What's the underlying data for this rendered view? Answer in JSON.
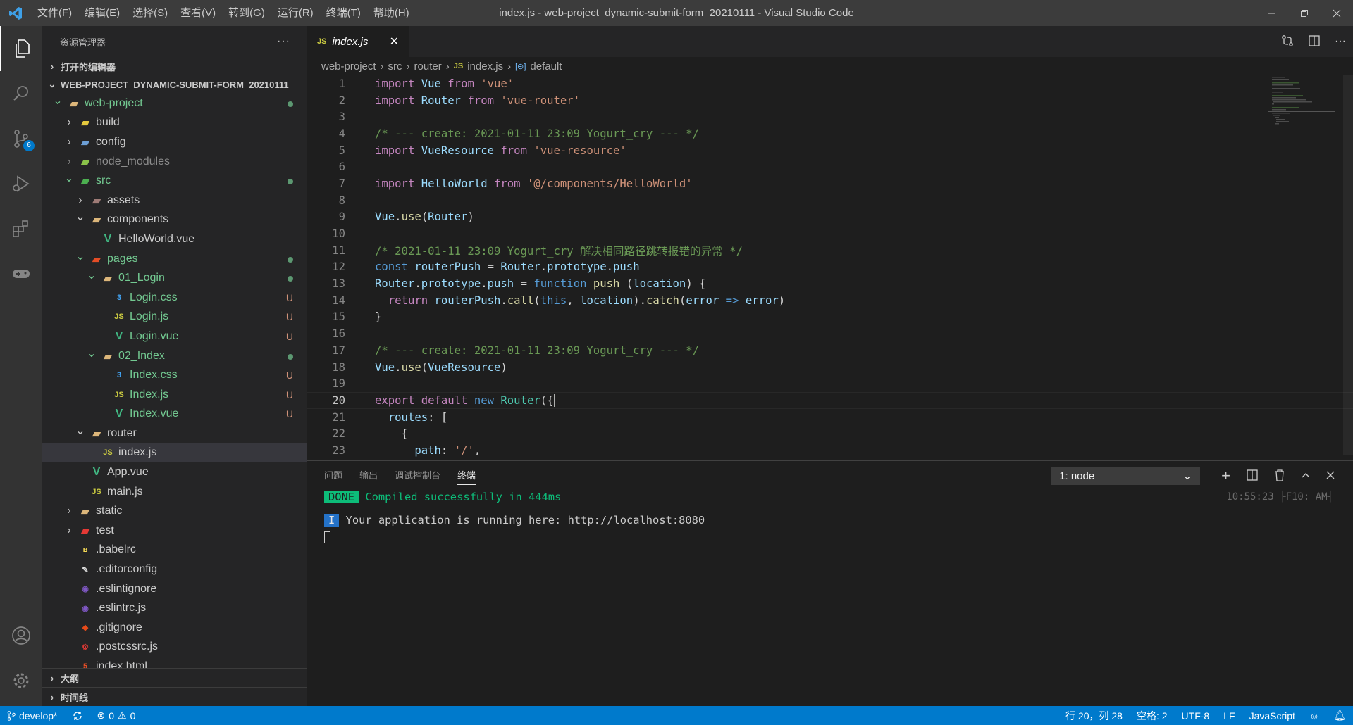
{
  "window": {
    "title": "index.js - web-project_dynamic-submit-form_20210111 - Visual Studio Code"
  },
  "menu": [
    "文件(F)",
    "编辑(E)",
    "选择(S)",
    "查看(V)",
    "转到(G)",
    "运行(R)",
    "终端(T)",
    "帮助(H)"
  ],
  "activity": {
    "scm_badge": "6"
  },
  "explorer": {
    "title": "资源管理器",
    "open_editors": "打开的编辑器",
    "root": "WEB-PROJECT_DYNAMIC-SUBMIT-FORM_20210111",
    "outline": "大纲",
    "timeline": "时间线"
  },
  "tree": [
    {
      "label": "web-project",
      "depth": 0,
      "twistie": "v",
      "icon": "folder",
      "status": "dot",
      "git": true
    },
    {
      "label": "build",
      "depth": 1,
      "twistie": ">",
      "icon": "folder-build",
      "status": ""
    },
    {
      "label": "config",
      "depth": 1,
      "twistie": ">",
      "icon": "folder-config",
      "status": ""
    },
    {
      "label": "node_modules",
      "depth": 1,
      "twistie": ">",
      "icon": "folder-node",
      "status": "",
      "ignored": true
    },
    {
      "label": "src",
      "depth": 1,
      "twistie": "v",
      "icon": "folder-src",
      "status": "dot",
      "git": true
    },
    {
      "label": "assets",
      "depth": 2,
      "twistie": ">",
      "icon": "folder-assets",
      "status": ""
    },
    {
      "label": "components",
      "depth": 2,
      "twistie": "v",
      "icon": "folder",
      "status": ""
    },
    {
      "label": "HelloWorld.vue",
      "depth": 3,
      "twistie": "",
      "icon": "vue",
      "status": ""
    },
    {
      "label": "pages",
      "depth": 2,
      "twistie": "v",
      "icon": "folder-pages",
      "status": "dot",
      "git": true
    },
    {
      "label": "01_Login",
      "depth": 3,
      "twistie": "v",
      "icon": "folder",
      "status": "dot",
      "git": true
    },
    {
      "label": "Login.css",
      "depth": 4,
      "twistie": "",
      "icon": "css",
      "status": "U",
      "git": true
    },
    {
      "label": "Login.js",
      "depth": 4,
      "twistie": "",
      "icon": "js",
      "status": "U",
      "git": true
    },
    {
      "label": "Login.vue",
      "depth": 4,
      "twistie": "",
      "icon": "vue",
      "status": "U",
      "git": true
    },
    {
      "label": "02_Index",
      "depth": 3,
      "twistie": "v",
      "icon": "folder",
      "status": "dot",
      "git": true
    },
    {
      "label": "Index.css",
      "depth": 4,
      "twistie": "",
      "icon": "css",
      "status": "U",
      "git": true
    },
    {
      "label": "Index.js",
      "depth": 4,
      "twistie": "",
      "icon": "js",
      "status": "U",
      "git": true
    },
    {
      "label": "Index.vue",
      "depth": 4,
      "twistie": "",
      "icon": "vue",
      "status": "U",
      "git": true
    },
    {
      "label": "router",
      "depth": 2,
      "twistie": "v",
      "icon": "folder",
      "status": ""
    },
    {
      "label": "index.js",
      "depth": 3,
      "twistie": "",
      "icon": "js",
      "status": "",
      "selected": true
    },
    {
      "label": "App.vue",
      "depth": 2,
      "twistie": "",
      "icon": "vue",
      "status": ""
    },
    {
      "label": "main.js",
      "depth": 2,
      "twistie": "",
      "icon": "js",
      "status": ""
    },
    {
      "label": "static",
      "depth": 1,
      "twistie": ">",
      "icon": "folder",
      "status": ""
    },
    {
      "label": "test",
      "depth": 1,
      "twistie": ">",
      "icon": "folder-test",
      "status": ""
    },
    {
      "label": ".babelrc",
      "depth": 1,
      "twistie": "",
      "icon": "babel",
      "status": ""
    },
    {
      "label": ".editorconfig",
      "depth": 1,
      "twistie": "",
      "icon": "editorconfig",
      "status": ""
    },
    {
      "label": ".eslintignore",
      "depth": 1,
      "twistie": "",
      "icon": "eslint",
      "status": ""
    },
    {
      "label": ".eslintrc.js",
      "depth": 1,
      "twistie": "",
      "icon": "eslint",
      "status": ""
    },
    {
      "label": ".gitignore",
      "depth": 1,
      "twistie": "",
      "icon": "git",
      "status": ""
    },
    {
      "label": ".postcssrc.js",
      "depth": 1,
      "twistie": "",
      "icon": "postcss",
      "status": ""
    },
    {
      "label": "index.html",
      "depth": 1,
      "twistie": "",
      "icon": "html",
      "status": ""
    }
  ],
  "tab": {
    "label": "index.js",
    "icon": "JS"
  },
  "breadcrumb": [
    "web-project",
    "src",
    "router",
    "index.js",
    "default"
  ],
  "code": [
    [
      [
        "kw",
        "import"
      ],
      [
        "t",
        " "
      ],
      [
        "id",
        "Vue"
      ],
      [
        "t",
        " "
      ],
      [
        "kw",
        "from"
      ],
      [
        "t",
        " "
      ],
      [
        "st",
        "'vue'"
      ]
    ],
    [
      [
        "kw",
        "import"
      ],
      [
        "t",
        " "
      ],
      [
        "id",
        "Router"
      ],
      [
        "t",
        " "
      ],
      [
        "kw",
        "from"
      ],
      [
        "t",
        " "
      ],
      [
        "st",
        "'vue-router'"
      ]
    ],
    [],
    [
      [
        "cm",
        "/* --- create: 2021-01-11 23:09 Yogurt_cry --- */"
      ]
    ],
    [
      [
        "kw",
        "import"
      ],
      [
        "t",
        " "
      ],
      [
        "id",
        "VueResource"
      ],
      [
        "t",
        " "
      ],
      [
        "kw",
        "from"
      ],
      [
        "t",
        " "
      ],
      [
        "st",
        "'vue-resource'"
      ]
    ],
    [],
    [
      [
        "kw",
        "import"
      ],
      [
        "t",
        " "
      ],
      [
        "id",
        "HelloWorld"
      ],
      [
        "t",
        " "
      ],
      [
        "kw",
        "from"
      ],
      [
        "t",
        " "
      ],
      [
        "st",
        "'@/components/HelloWorld'"
      ]
    ],
    [],
    [
      [
        "id",
        "Vue"
      ],
      [
        "t",
        "."
      ],
      [
        "fn",
        "use"
      ],
      [
        "t",
        "("
      ],
      [
        "id",
        "Router"
      ],
      [
        "t",
        ")"
      ]
    ],
    [],
    [
      [
        "cm",
        "/* 2021-01-11 23:09 Yogurt_cry 解决相同路径跳转报错的异常 */"
      ]
    ],
    [
      [
        "bl",
        "const"
      ],
      [
        "t",
        " "
      ],
      [
        "id",
        "routerPush"
      ],
      [
        "t",
        " = "
      ],
      [
        "id",
        "Router"
      ],
      [
        "t",
        "."
      ],
      [
        "id",
        "prototype"
      ],
      [
        "t",
        "."
      ],
      [
        "id",
        "push"
      ]
    ],
    [
      [
        "id",
        "Router"
      ],
      [
        "t",
        "."
      ],
      [
        "id",
        "prototype"
      ],
      [
        "t",
        "."
      ],
      [
        "id",
        "push"
      ],
      [
        "t",
        " = "
      ],
      [
        "bl",
        "function"
      ],
      [
        "t",
        " "
      ],
      [
        "fn",
        "push"
      ],
      [
        "t",
        " ("
      ],
      [
        "id",
        "location"
      ],
      [
        "t",
        ") {"
      ]
    ],
    [
      [
        "t",
        "  "
      ],
      [
        "kw",
        "return"
      ],
      [
        "t",
        " "
      ],
      [
        "id",
        "routerPush"
      ],
      [
        "t",
        "."
      ],
      [
        "fn",
        "call"
      ],
      [
        "t",
        "("
      ],
      [
        "bl",
        "this"
      ],
      [
        "t",
        ", "
      ],
      [
        "id",
        "location"
      ],
      [
        "t",
        ")."
      ],
      [
        "fn",
        "catch"
      ],
      [
        "t",
        "("
      ],
      [
        "id",
        "error"
      ],
      [
        "t",
        " "
      ],
      [
        "bl",
        "=>"
      ],
      [
        "t",
        " "
      ],
      [
        "id",
        "error"
      ],
      [
        "t",
        ")"
      ]
    ],
    [
      [
        "t",
        "}"
      ]
    ],
    [],
    [
      [
        "cm",
        "/* --- create: 2021-01-11 23:09 Yogurt_cry --- */"
      ]
    ],
    [
      [
        "id",
        "Vue"
      ],
      [
        "t",
        "."
      ],
      [
        "fn",
        "use"
      ],
      [
        "t",
        "("
      ],
      [
        "id",
        "VueResource"
      ],
      [
        "t",
        ")"
      ]
    ],
    [],
    [
      [
        "kw",
        "export"
      ],
      [
        "t",
        " "
      ],
      [
        "kw",
        "default"
      ],
      [
        "t",
        " "
      ],
      [
        "bl",
        "new"
      ],
      [
        "t",
        " "
      ],
      [
        "ty",
        "Router"
      ],
      [
        "t",
        "({"
      ]
    ],
    [
      [
        "t",
        "  "
      ],
      [
        "id",
        "routes"
      ],
      [
        "t",
        ": ["
      ]
    ],
    [
      [
        "t",
        "    {"
      ]
    ],
    [
      [
        "t",
        "      "
      ],
      [
        "id",
        "path"
      ],
      [
        "t",
        ": "
      ],
      [
        "st",
        "'/'"
      ],
      [
        "t",
        ","
      ]
    ]
  ],
  "current_line": 20,
  "panel": {
    "tabs": [
      "问题",
      "输出",
      "调试控制台",
      "终端"
    ],
    "terminal_select": "1: node",
    "lines": [
      {
        "tag": "DONE",
        "text": " Compiled successfully in 444ms",
        "time": "10:55:23 ├F10: AM┤"
      },
      {
        "tag": "",
        "text": ""
      },
      {
        "tag": "I",
        "text": " Your application is running here: http://localhost:8080"
      }
    ]
  },
  "status": {
    "branch": "develop*",
    "errors": "0",
    "warnings": "0",
    "position": "行 20，列 28",
    "spaces": "空格: 2",
    "encoding": "UTF-8",
    "eol": "LF",
    "language": "JavaScript"
  },
  "colors": {
    "accent": "#007acc",
    "git_untracked": "#73c991"
  }
}
